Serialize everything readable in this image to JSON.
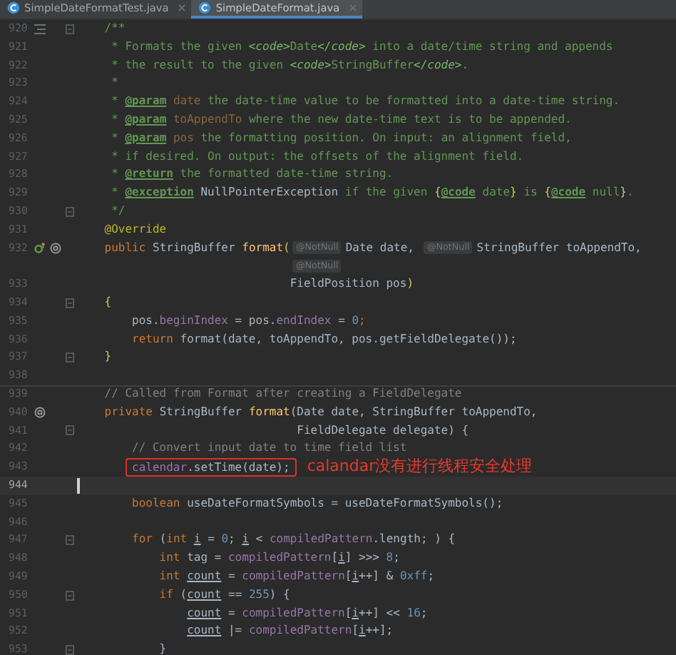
{
  "tabs": [
    {
      "label": "SimpleDateFormatTest.java",
      "selected": false
    },
    {
      "label": "SimpleDateFormat.java",
      "selected": true
    }
  ],
  "lines": [
    {
      "kind": "code",
      "number": "920",
      "gutter": [
        {
          "kind": "doc"
        }
      ],
      "fold": true,
      "current": false,
      "boxed": false,
      "separator": false,
      "tokens": [
        {
          "text": "    /**",
          "kind": "doc"
        }
      ]
    },
    {
      "kind": "code",
      "number": "921",
      "fold": false,
      "current": false,
      "boxed": false,
      "separator": false,
      "tokens": [
        {
          "text": "     * Formats the given ",
          "kind": "doc"
        },
        {
          "text": "<code>",
          "kind": "html"
        },
        {
          "text": "Date",
          "kind": "doc"
        },
        {
          "text": "</code>",
          "kind": "html"
        },
        {
          "text": " into a date/time string and appends",
          "kind": "doc"
        }
      ]
    },
    {
      "kind": "code",
      "number": "922",
      "fold": false,
      "current": false,
      "boxed": false,
      "separator": false,
      "tokens": [
        {
          "text": "     * the result to the given ",
          "kind": "doc"
        },
        {
          "text": "<code>",
          "kind": "html"
        },
        {
          "text": "StringBuffer",
          "kind": "doc"
        },
        {
          "text": "</code>",
          "kind": "html"
        },
        {
          "text": ".",
          "kind": "doc"
        }
      ]
    },
    {
      "kind": "code",
      "number": "923",
      "fold": false,
      "current": false,
      "boxed": false,
      "separator": false,
      "tokens": [
        {
          "text": "     *",
          "kind": "doc"
        }
      ]
    },
    {
      "kind": "code",
      "number": "924",
      "fold": false,
      "current": false,
      "boxed": false,
      "separator": false,
      "tokens": [
        {
          "text": "     * ",
          "kind": "doc"
        },
        {
          "text": "@param",
          "kind": "tag"
        },
        {
          "text": " date",
          "kind": "param"
        },
        {
          "text": " the date-time value to be formatted into a date-time string.",
          "kind": "doc"
        }
      ]
    },
    {
      "kind": "code",
      "number": "925",
      "fold": false,
      "current": false,
      "boxed": false,
      "separator": false,
      "tokens": [
        {
          "text": "     * ",
          "kind": "doc"
        },
        {
          "text": "@param",
          "kind": "tag"
        },
        {
          "text": " toAppendTo",
          "kind": "param"
        },
        {
          "text": " where the new date-time text is to be appended.",
          "kind": "doc"
        }
      ]
    },
    {
      "kind": "code",
      "number": "926",
      "fold": false,
      "current": false,
      "boxed": false,
      "separator": false,
      "tokens": [
        {
          "text": "     * ",
          "kind": "doc"
        },
        {
          "text": "@param",
          "kind": "tag"
        },
        {
          "text": " pos",
          "kind": "param"
        },
        {
          "text": " the formatting position. On input: an alignment field,",
          "kind": "doc"
        }
      ]
    },
    {
      "kind": "code",
      "number": "927",
      "fold": false,
      "current": false,
      "boxed": false,
      "separator": false,
      "tokens": [
        {
          "text": "     * if desired. On output: the offsets of the alignment field.",
          "kind": "doc"
        }
      ]
    },
    {
      "kind": "code",
      "number": "928",
      "fold": false,
      "current": false,
      "boxed": false,
      "separator": false,
      "tokens": [
        {
          "text": "     * ",
          "kind": "doc"
        },
        {
          "text": "@return",
          "kind": "tag"
        },
        {
          "text": " the formatted date-time string.",
          "kind": "doc"
        }
      ]
    },
    {
      "kind": "code",
      "number": "929",
      "fold": false,
      "current": false,
      "boxed": false,
      "separator": false,
      "tokens": [
        {
          "text": "     * ",
          "kind": "doc"
        },
        {
          "text": "@exception",
          "kind": "tag"
        },
        {
          "text": " NullPointerException",
          "kind": "ref"
        },
        {
          "text": " if the given ",
          "kind": "doc"
        },
        {
          "text": "{",
          "kind": "brace"
        },
        {
          "text": "@code",
          "kind": "tag"
        },
        {
          "text": " date",
          "kind": "doc"
        },
        {
          "text": "}",
          "kind": "brace"
        },
        {
          "text": " is ",
          "kind": "doc"
        },
        {
          "text": "{",
          "kind": "brace"
        },
        {
          "text": "@code",
          "kind": "tag"
        },
        {
          "text": " null",
          "kind": "doc"
        },
        {
          "text": "}",
          "kind": "brace"
        },
        {
          "text": ".",
          "kind": "doc"
        }
      ]
    },
    {
      "kind": "code",
      "number": "930",
      "fold": true,
      "current": false,
      "boxed": false,
      "separator": false,
      "tokens": [
        {
          "text": "     */",
          "kind": "doc"
        }
      ]
    },
    {
      "kind": "code",
      "number": "931",
      "fold": false,
      "current": false,
      "boxed": false,
      "separator": false,
      "tokens": [
        {
          "text": "    @Override",
          "kind": "anno"
        }
      ]
    },
    {
      "kind": "code",
      "number": "932",
      "gutter": [
        {
          "kind": "override"
        },
        {
          "kind": "at"
        }
      ],
      "fold": false,
      "current": false,
      "boxed": false,
      "separator": false,
      "tokens": [
        {
          "text": "    public",
          "kind": "kw"
        },
        {
          "text": " StringBuffer ",
          "kind": "plain"
        },
        {
          "text": "format",
          "kind": "method"
        },
        {
          "text": "(",
          "kind": "brace"
        },
        {
          "text": "@NotNull",
          "kind": "inlay"
        },
        {
          "text": "Date date, ",
          "kind": "plain"
        },
        {
          "text": "@NotNull",
          "kind": "inlay"
        },
        {
          "text": "StringBuffer toAppendTo,",
          "kind": "plain"
        }
      ]
    },
    {
      "kind": "hint",
      "fold": false,
      "current": false,
      "boxed": false,
      "separator": false,
      "tokens": [
        {
          "text": "                               @NotNull",
          "kind": "inlay"
        }
      ]
    },
    {
      "kind": "code",
      "number": "933",
      "fold": false,
      "current": false,
      "boxed": false,
      "separator": false,
      "tokens": [
        {
          "text": "                               FieldPosition pos",
          "kind": "plain"
        },
        {
          "text": ")",
          "kind": "brace"
        }
      ]
    },
    {
      "kind": "code",
      "number": "934",
      "fold": true,
      "current": false,
      "boxed": false,
      "separator": false,
      "tokens": [
        {
          "text": "    {",
          "kind": "brace"
        }
      ]
    },
    {
      "kind": "code",
      "number": "935",
      "fold": false,
      "current": false,
      "boxed": false,
      "separator": false,
      "tokens": [
        {
          "text": "        pos.",
          "kind": "plain"
        },
        {
          "text": "beginIndex",
          "kind": "field"
        },
        {
          "text": " = pos.",
          "kind": "plain"
        },
        {
          "text": "endIndex",
          "kind": "field"
        },
        {
          "text": " = ",
          "kind": "plain"
        },
        {
          "text": "0",
          "kind": "num"
        },
        {
          "text": ";",
          "kind": "kw"
        }
      ]
    },
    {
      "kind": "code",
      "number": "936",
      "fold": false,
      "current": false,
      "boxed": false,
      "separator": false,
      "tokens": [
        {
          "text": "        return",
          "kind": "kw"
        },
        {
          "text": " format(date, toAppendTo, pos.getFieldDelegate());",
          "kind": "plain"
        }
      ]
    },
    {
      "kind": "code",
      "number": "937",
      "fold": true,
      "current": false,
      "boxed": false,
      "separator": false,
      "tokens": [
        {
          "text": "    }",
          "kind": "brace"
        }
      ]
    },
    {
      "kind": "code",
      "number": "938",
      "fold": false,
      "current": false,
      "boxed": false,
      "separator": false
    },
    {
      "kind": "code",
      "number": "939",
      "fold": false,
      "current": false,
      "boxed": false,
      "separator": true,
      "tokens": [
        {
          "text": "    // Called from Format after creating a FieldDelegate",
          "kind": "comment"
        }
      ]
    },
    {
      "kind": "code",
      "number": "940",
      "gutter": [
        {
          "kind": "at"
        }
      ],
      "fold": false,
      "current": false,
      "boxed": false,
      "separator": false,
      "tokens": [
        {
          "text": "    private",
          "kind": "kw"
        },
        {
          "text": " StringBuffer ",
          "kind": "plain"
        },
        {
          "text": "format",
          "kind": "method"
        },
        {
          "text": "(Date date, StringBuffer toAppendTo,",
          "kind": "plain"
        }
      ]
    },
    {
      "kind": "code",
      "number": "941",
      "fold": true,
      "current": false,
      "boxed": false,
      "separator": false,
      "tokens": [
        {
          "text": "                                FieldDelegate delegate) {",
          "kind": "plain"
        }
      ]
    },
    {
      "kind": "code",
      "number": "942",
      "fold": false,
      "current": false,
      "boxed": false,
      "separator": false,
      "tokens": [
        {
          "text": "        // Convert input date to time field list",
          "kind": "comment"
        }
      ]
    },
    {
      "kind": "code",
      "number": "943",
      "fold": false,
      "current": false,
      "boxed": true,
      "separator": false,
      "note": "calandar没有进行线程安全处理",
      "tokens": [
        {
          "text": "        calendar",
          "kind": "field"
        },
        {
          "text": ".setTime(date);",
          "kind": "plain"
        }
      ]
    },
    {
      "kind": "code",
      "number": "944",
      "fold": false,
      "current": true,
      "boxed": false,
      "separator": false
    },
    {
      "kind": "code",
      "number": "945",
      "fold": false,
      "current": false,
      "boxed": false,
      "separator": false,
      "tokens": [
        {
          "text": "        boolean",
          "kind": "kw"
        },
        {
          "text": " useDateFormatSymbols = useDateFormatSymbols();",
          "kind": "plain"
        }
      ]
    },
    {
      "kind": "code",
      "number": "946",
      "fold": false,
      "current": false,
      "boxed": false,
      "separator": false
    },
    {
      "kind": "code",
      "number": "947",
      "fold": true,
      "current": false,
      "boxed": false,
      "separator": false,
      "tokens": [
        {
          "text": "        for",
          "kind": "kw"
        },
        {
          "text": " (",
          "kind": "plain"
        },
        {
          "text": "int",
          "kind": "kw"
        },
        {
          "text": " i",
          "kind": "var"
        },
        {
          "text": " = ",
          "kind": "plain"
        },
        {
          "text": "0",
          "kind": "num"
        },
        {
          "text": "; ",
          "kind": "plain"
        },
        {
          "text": "i",
          "kind": "var"
        },
        {
          "text": " < ",
          "kind": "plain"
        },
        {
          "text": "compiledPattern",
          "kind": "field"
        },
        {
          "text": ".length; ) {",
          "kind": "plain"
        }
      ]
    },
    {
      "kind": "code",
      "number": "948",
      "fold": false,
      "current": false,
      "boxed": false,
      "separator": false,
      "tokens": [
        {
          "text": "            int",
          "kind": "kw"
        },
        {
          "text": " tag = ",
          "kind": "plain"
        },
        {
          "text": "compiledPattern",
          "kind": "field"
        },
        {
          "text": "[",
          "kind": "plain"
        },
        {
          "text": "i",
          "kind": "var"
        },
        {
          "text": "] >>> ",
          "kind": "plain"
        },
        {
          "text": "8",
          "kind": "num"
        },
        {
          "text": ";",
          "kind": "plain"
        }
      ]
    },
    {
      "kind": "code",
      "number": "949",
      "fold": false,
      "current": false,
      "boxed": false,
      "separator": false,
      "tokens": [
        {
          "text": "            int",
          "kind": "kw"
        },
        {
          "text": " count",
          "kind": "var"
        },
        {
          "text": " = ",
          "kind": "plain"
        },
        {
          "text": "compiledPattern",
          "kind": "field"
        },
        {
          "text": "[",
          "kind": "plain"
        },
        {
          "text": "i",
          "kind": "var"
        },
        {
          "text": "++] & ",
          "kind": "plain"
        },
        {
          "text": "0xff",
          "kind": "num"
        },
        {
          "text": ";",
          "kind": "plain"
        }
      ]
    },
    {
      "kind": "code",
      "number": "950",
      "fold": true,
      "current": false,
      "boxed": false,
      "separator": false,
      "tokens": [
        {
          "text": "            if",
          "kind": "kw"
        },
        {
          "text": " (",
          "kind": "plain"
        },
        {
          "text": "count",
          "kind": "var"
        },
        {
          "text": " == ",
          "kind": "plain"
        },
        {
          "text": "255",
          "kind": "num"
        },
        {
          "text": ") {",
          "kind": "plain"
        }
      ]
    },
    {
      "kind": "code",
      "number": "951",
      "fold": false,
      "current": false,
      "boxed": false,
      "separator": false,
      "tokens": [
        {
          "text": "                count",
          "kind": "var"
        },
        {
          "text": " = ",
          "kind": "plain"
        },
        {
          "text": "compiledPattern",
          "kind": "field"
        },
        {
          "text": "[",
          "kind": "plain"
        },
        {
          "text": "i",
          "kind": "var"
        },
        {
          "text": "++] << ",
          "kind": "plain"
        },
        {
          "text": "16",
          "kind": "num"
        },
        {
          "text": ";",
          "kind": "plain"
        }
      ]
    },
    {
      "kind": "code",
      "number": "952",
      "fold": false,
      "current": false,
      "boxed": false,
      "separator": false,
      "tokens": [
        {
          "text": "                count",
          "kind": "var"
        },
        {
          "text": " |= ",
          "kind": "plain"
        },
        {
          "text": "compiledPattern",
          "kind": "field"
        },
        {
          "text": "[",
          "kind": "plain"
        },
        {
          "text": "i",
          "kind": "var"
        },
        {
          "text": "++];",
          "kind": "plain"
        }
      ]
    },
    {
      "kind": "code",
      "number": "953",
      "fold": true,
      "current": false,
      "boxed": false,
      "separator": false,
      "tokens": [
        {
          "text": "            }",
          "kind": "plain"
        }
      ]
    }
  ]
}
